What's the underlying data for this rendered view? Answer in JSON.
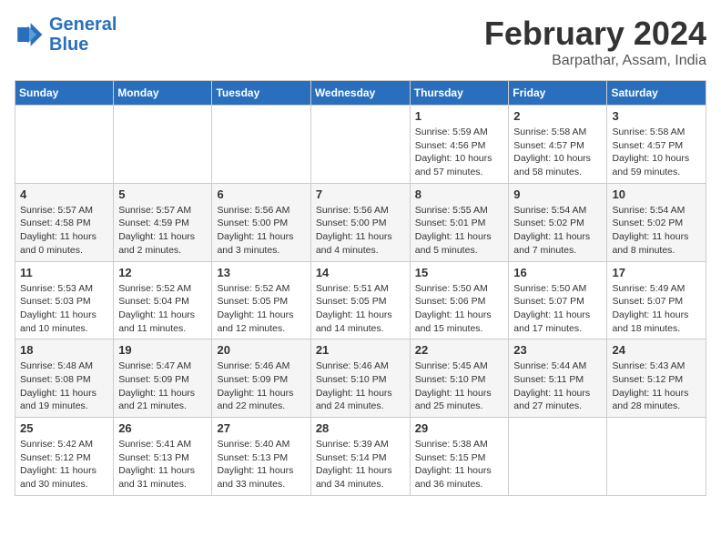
{
  "header": {
    "logo_line1": "General",
    "logo_line2": "Blue",
    "month": "February 2024",
    "location": "Barpathar, Assam, India"
  },
  "days_of_week": [
    "Sunday",
    "Monday",
    "Tuesday",
    "Wednesday",
    "Thursday",
    "Friday",
    "Saturday"
  ],
  "weeks": [
    [
      {
        "day": "",
        "info": ""
      },
      {
        "day": "",
        "info": ""
      },
      {
        "day": "",
        "info": ""
      },
      {
        "day": "",
        "info": ""
      },
      {
        "day": "1",
        "info": "Sunrise: 5:59 AM\nSunset: 4:56 PM\nDaylight: 10 hours\nand 57 minutes."
      },
      {
        "day": "2",
        "info": "Sunrise: 5:58 AM\nSunset: 4:57 PM\nDaylight: 10 hours\nand 58 minutes."
      },
      {
        "day": "3",
        "info": "Sunrise: 5:58 AM\nSunset: 4:57 PM\nDaylight: 10 hours\nand 59 minutes."
      }
    ],
    [
      {
        "day": "4",
        "info": "Sunrise: 5:57 AM\nSunset: 4:58 PM\nDaylight: 11 hours\nand 0 minutes."
      },
      {
        "day": "5",
        "info": "Sunrise: 5:57 AM\nSunset: 4:59 PM\nDaylight: 11 hours\nand 2 minutes."
      },
      {
        "day": "6",
        "info": "Sunrise: 5:56 AM\nSunset: 5:00 PM\nDaylight: 11 hours\nand 3 minutes."
      },
      {
        "day": "7",
        "info": "Sunrise: 5:56 AM\nSunset: 5:00 PM\nDaylight: 11 hours\nand 4 minutes."
      },
      {
        "day": "8",
        "info": "Sunrise: 5:55 AM\nSunset: 5:01 PM\nDaylight: 11 hours\nand 5 minutes."
      },
      {
        "day": "9",
        "info": "Sunrise: 5:54 AM\nSunset: 5:02 PM\nDaylight: 11 hours\nand 7 minutes."
      },
      {
        "day": "10",
        "info": "Sunrise: 5:54 AM\nSunset: 5:02 PM\nDaylight: 11 hours\nand 8 minutes."
      }
    ],
    [
      {
        "day": "11",
        "info": "Sunrise: 5:53 AM\nSunset: 5:03 PM\nDaylight: 11 hours\nand 10 minutes."
      },
      {
        "day": "12",
        "info": "Sunrise: 5:52 AM\nSunset: 5:04 PM\nDaylight: 11 hours\nand 11 minutes."
      },
      {
        "day": "13",
        "info": "Sunrise: 5:52 AM\nSunset: 5:05 PM\nDaylight: 11 hours\nand 12 minutes."
      },
      {
        "day": "14",
        "info": "Sunrise: 5:51 AM\nSunset: 5:05 PM\nDaylight: 11 hours\nand 14 minutes."
      },
      {
        "day": "15",
        "info": "Sunrise: 5:50 AM\nSunset: 5:06 PM\nDaylight: 11 hours\nand 15 minutes."
      },
      {
        "day": "16",
        "info": "Sunrise: 5:50 AM\nSunset: 5:07 PM\nDaylight: 11 hours\nand 17 minutes."
      },
      {
        "day": "17",
        "info": "Sunrise: 5:49 AM\nSunset: 5:07 PM\nDaylight: 11 hours\nand 18 minutes."
      }
    ],
    [
      {
        "day": "18",
        "info": "Sunrise: 5:48 AM\nSunset: 5:08 PM\nDaylight: 11 hours\nand 19 minutes."
      },
      {
        "day": "19",
        "info": "Sunrise: 5:47 AM\nSunset: 5:09 PM\nDaylight: 11 hours\nand 21 minutes."
      },
      {
        "day": "20",
        "info": "Sunrise: 5:46 AM\nSunset: 5:09 PM\nDaylight: 11 hours\nand 22 minutes."
      },
      {
        "day": "21",
        "info": "Sunrise: 5:46 AM\nSunset: 5:10 PM\nDaylight: 11 hours\nand 24 minutes."
      },
      {
        "day": "22",
        "info": "Sunrise: 5:45 AM\nSunset: 5:10 PM\nDaylight: 11 hours\nand 25 minutes."
      },
      {
        "day": "23",
        "info": "Sunrise: 5:44 AM\nSunset: 5:11 PM\nDaylight: 11 hours\nand 27 minutes."
      },
      {
        "day": "24",
        "info": "Sunrise: 5:43 AM\nSunset: 5:12 PM\nDaylight: 11 hours\nand 28 minutes."
      }
    ],
    [
      {
        "day": "25",
        "info": "Sunrise: 5:42 AM\nSunset: 5:12 PM\nDaylight: 11 hours\nand 30 minutes."
      },
      {
        "day": "26",
        "info": "Sunrise: 5:41 AM\nSunset: 5:13 PM\nDaylight: 11 hours\nand 31 minutes."
      },
      {
        "day": "27",
        "info": "Sunrise: 5:40 AM\nSunset: 5:13 PM\nDaylight: 11 hours\nand 33 minutes."
      },
      {
        "day": "28",
        "info": "Sunrise: 5:39 AM\nSunset: 5:14 PM\nDaylight: 11 hours\nand 34 minutes."
      },
      {
        "day": "29",
        "info": "Sunrise: 5:38 AM\nSunset: 5:15 PM\nDaylight: 11 hours\nand 36 minutes."
      },
      {
        "day": "",
        "info": ""
      },
      {
        "day": "",
        "info": ""
      }
    ]
  ]
}
